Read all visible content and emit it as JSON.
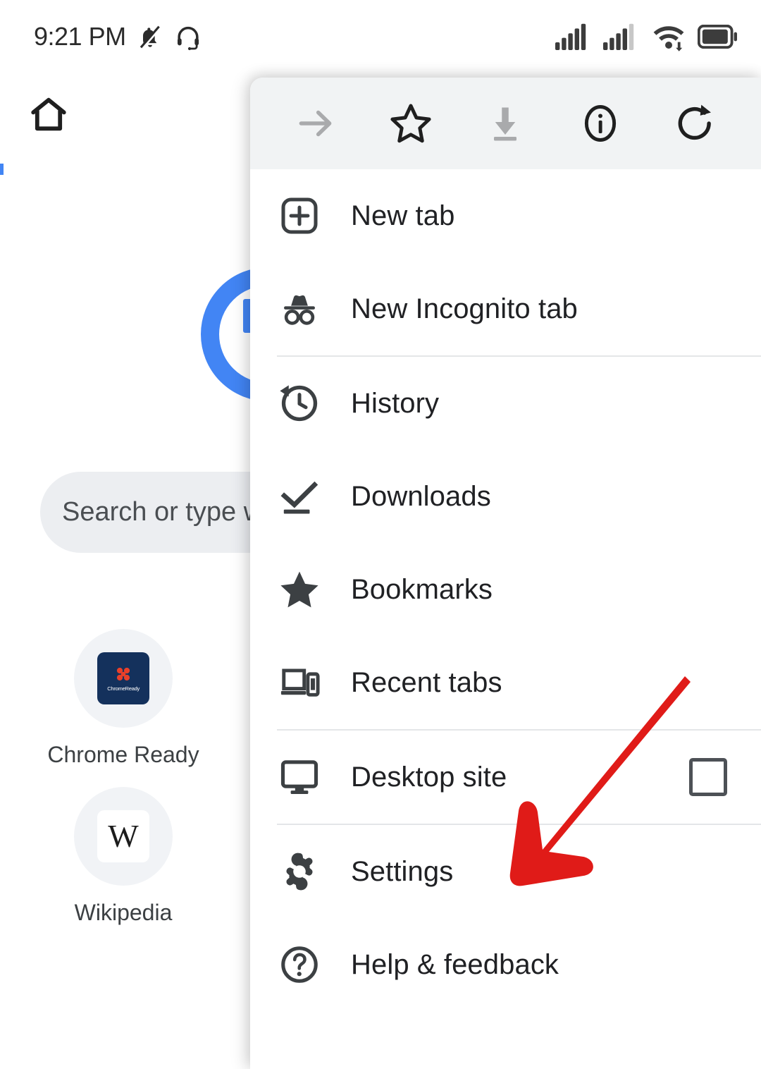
{
  "status_bar": {
    "clock": "9:21 PM",
    "icons": [
      {
        "name": "notifications-muted-icon"
      },
      {
        "name": "headset-icon"
      },
      {
        "name": "signal-bars-sim1-icon",
        "bars_filled": 5,
        "bars_total": 5
      },
      {
        "name": "signal-bars-sim2-icon",
        "bars_filled": 4,
        "bars_total": 5
      },
      {
        "name": "wifi-icon"
      },
      {
        "name": "battery-icon",
        "level_percent": 85
      }
    ]
  },
  "ntp": {
    "home_icon": "home-icon",
    "logo_icon": "chrome-logo",
    "search": {
      "placeholder": "Search or type w",
      "icon": "search-icon"
    },
    "shortcuts": [
      {
        "label": "Chrome Ready",
        "tile_text": "ChromeReady",
        "tile_color": "#14315c",
        "icon": "chrome-ready-favicon"
      },
      {
        "label": "Wikipedia",
        "tile_text": "W",
        "tile_color": "#ffffff",
        "icon": "wikipedia-favicon"
      }
    ]
  },
  "menu": {
    "toolbar": [
      {
        "name": "forward-arrow-icon",
        "label": "Forward",
        "enabled": false
      },
      {
        "name": "star-icon",
        "label": "Bookmark",
        "enabled": true
      },
      {
        "name": "download-icon",
        "label": "Download page",
        "enabled": false
      },
      {
        "name": "info-circle-icon",
        "label": "Page info",
        "enabled": true
      },
      {
        "name": "reload-icon",
        "label": "Reload",
        "enabled": true
      }
    ],
    "items": [
      {
        "label": "New tab",
        "icon": "new-tab-icon",
        "divider_after": false
      },
      {
        "label": "New Incognito tab",
        "icon": "incognito-icon",
        "divider_after": true
      },
      {
        "label": "History",
        "icon": "history-icon",
        "divider_after": false
      },
      {
        "label": "Downloads",
        "icon": "downloads-icon",
        "divider_after": false
      },
      {
        "label": "Bookmarks",
        "icon": "bookmarks-star-icon",
        "divider_after": false
      },
      {
        "label": "Recent tabs",
        "icon": "recent-tabs-icon",
        "divider_after": true
      },
      {
        "label": "Desktop site",
        "icon": "desktop-site-icon",
        "checkbox": false,
        "divider_after": true
      },
      {
        "label": "Settings",
        "icon": "settings-gear-icon",
        "divider_after": false
      },
      {
        "label": "Help & feedback",
        "icon": "help-circle-icon",
        "divider_after": false
      }
    ]
  },
  "annotation": {
    "name": "red-arrow-pointing-to-settings",
    "color": "#e01b18",
    "points_at": "Settings"
  }
}
